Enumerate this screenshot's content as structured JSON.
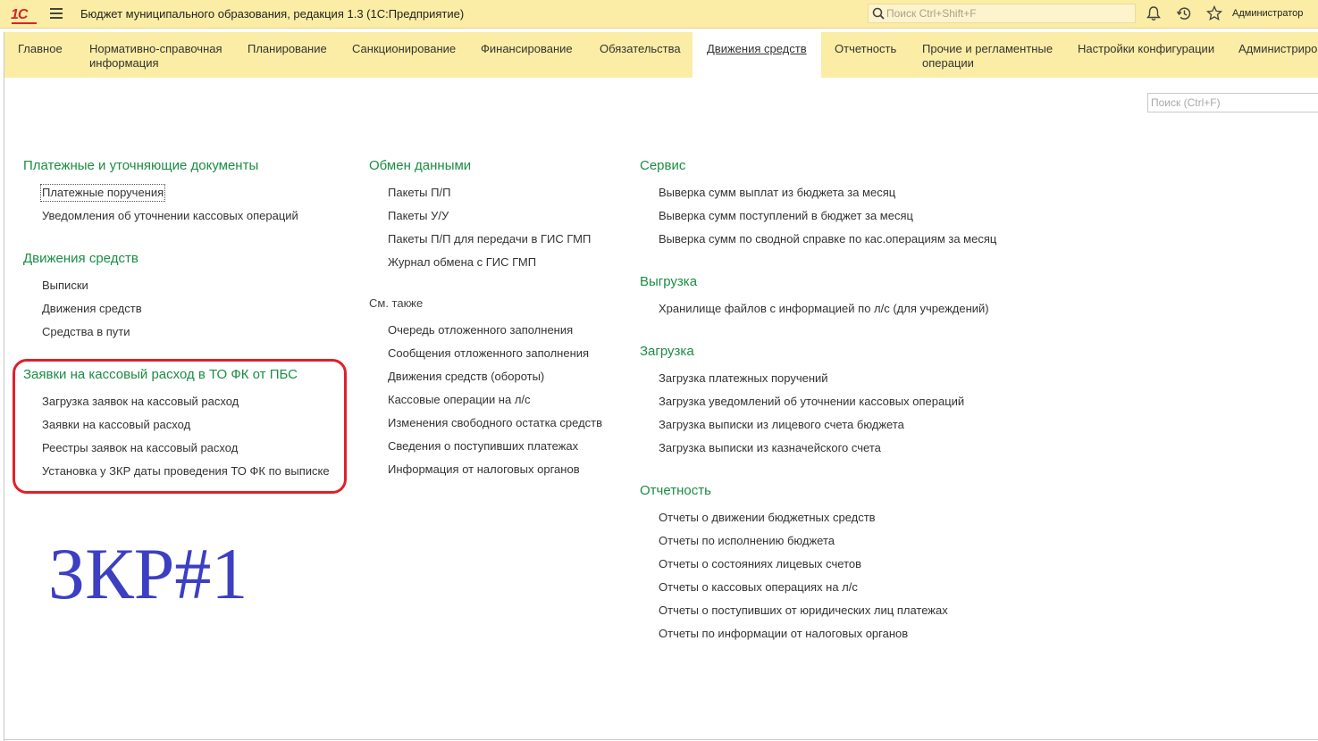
{
  "titlebar": {
    "logo": "1С",
    "title": "Бюджет муниципального образования, редакция 1.3  (1С:Предприятие)",
    "search_placeholder": "Поиск Ctrl+Shift+F",
    "user": "Администратор"
  },
  "sections": [
    "Главное",
    "Нормативно-справочная\nинформация",
    "Планирование",
    "Санкционирование",
    "Финансирование",
    "Обязательства",
    "Движения средств",
    "Отчетность",
    "Прочие и регламентные\nоперации",
    "Настройки конфигурации",
    "Администриров"
  ],
  "page_search_placeholder": "Поиск (Ctrl+F)",
  "col1": {
    "g1_title": "Платежные и уточняющие документы",
    "g1_items": [
      "Платежные поручения",
      "Уведомления об уточнении кассовых операций"
    ],
    "g2_title": "Движения средств",
    "g2_items": [
      "Выписки",
      "Движения средств",
      "Средства в пути"
    ],
    "g3_title": "Заявки на кассовый расход в ТО ФК от ПБС",
    "g3_items": [
      "Загрузка заявок на кассовый расход",
      "Заявки на кассовый расход",
      "Реестры заявок на кассовый расход",
      "Установка у ЗКР даты проведения ТО ФК по выписке"
    ]
  },
  "col2": {
    "g1_title": "Обмен данными",
    "g1_items": [
      "Пакеты П/П",
      "Пакеты У/У",
      "Пакеты П/П для передачи в ГИС ГМП",
      "Журнал обмена с ГИС ГМП"
    ],
    "see_also": "См. также",
    "see_items": [
      "Очередь отложенного заполнения",
      "Сообщения отложенного заполнения",
      "Движения средств (обороты)",
      "Кассовые операции на л/с",
      "Изменения свободного остатка средств",
      "Сведения о поступивших платежах",
      "Информация от налоговых органов"
    ]
  },
  "col3": {
    "g1_title": "Сервис",
    "g1_items": [
      "Выверка сумм выплат из бюджета за месяц",
      "Выверка сумм поступлений в бюджет за месяц",
      "Выверка сумм по сводной справке по кас.операциям за месяц"
    ],
    "g2_title": "Выгрузка",
    "g2_items": [
      "Хранилище файлов с информацией по л/с (для учреждений)"
    ],
    "g3_title": "Загрузка",
    "g3_items": [
      "Загрузка платежных поручений",
      "Загрузка уведомлений об уточнении кассовых операций",
      "Загрузка выписки из лицевого счета бюджета",
      "Загрузка выписки из казначейского счета"
    ],
    "g4_title": "Отчетность",
    "g4_items": [
      "Отчеты о движении бюджетных средств",
      "Отчеты по исполнению бюджета",
      "Отчеты о состояниях лицевых счетов",
      "Отчеты о кассовых операциях на л/с",
      "Отчеты о поступивших от юридических лиц платежах",
      "Отчеты по информации от налоговых органов"
    ]
  },
  "annotation": "ЗКР#1"
}
